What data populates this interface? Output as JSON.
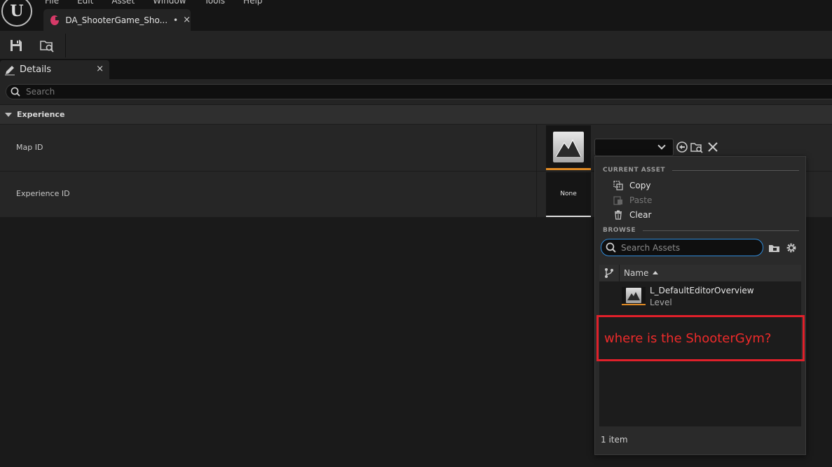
{
  "app": {
    "logo_letter": "U",
    "menu": [
      "File",
      "Edit",
      "Asset",
      "Window",
      "Tools",
      "Help"
    ],
    "document_tab": {
      "label": "DA_ShooterGame_Sho...",
      "dirty_marker": "•",
      "close": "×"
    }
  },
  "toolbar": {
    "save_icon": "save-icon",
    "browse_icon": "browse-to-asset-icon"
  },
  "details": {
    "tab_label": "Details",
    "tab_close": "×",
    "search_placeholder": "Search",
    "category": "Experience",
    "properties": [
      {
        "name": "Map ID",
        "value_type": "asset-thumbnail"
      },
      {
        "name": "Experience ID",
        "value": "None"
      }
    ]
  },
  "picker": {
    "current_asset_header": "CURRENT ASSET",
    "actions": [
      {
        "label": "Copy",
        "icon": "copy-icon",
        "enabled": true
      },
      {
        "label": "Paste",
        "icon": "paste-icon",
        "enabled": false
      },
      {
        "label": "Clear",
        "icon": "trash-icon",
        "enabled": true
      }
    ],
    "browse_header": "BROWSE",
    "search_placeholder": "Search Assets",
    "column_name": "Name",
    "assets": [
      {
        "name": "L_DefaultEditorOverview",
        "type": "Level"
      }
    ],
    "item_count": "1 item"
  },
  "annotation": {
    "text": "where is the ShooterGym?",
    "color": "#e0202a"
  },
  "colors": {
    "accent_orange": "#e08a24",
    "focus_blue": "#2f8ad8",
    "tab_icon_pink": "#d63a68"
  }
}
